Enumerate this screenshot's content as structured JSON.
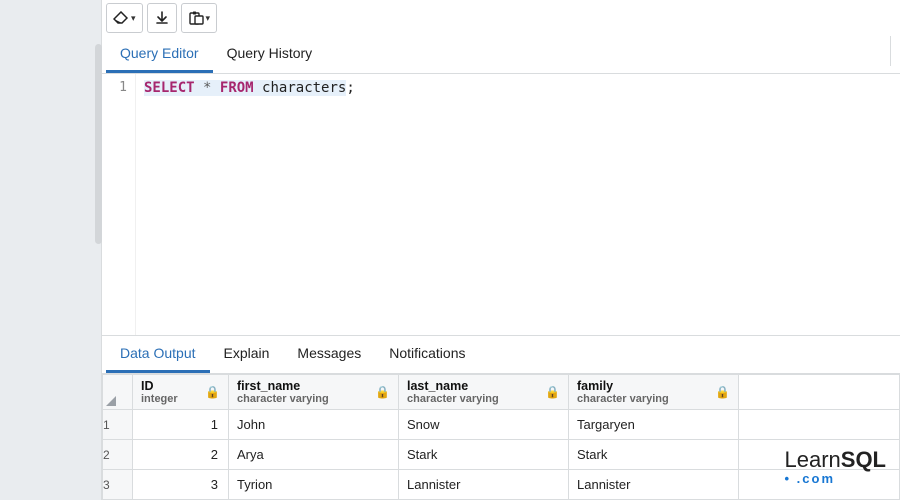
{
  "toolbar": {
    "buttons": [
      "erase",
      "download",
      "paste"
    ]
  },
  "editor_tabs": {
    "active": 0,
    "items": [
      "Query Editor",
      "Query History"
    ]
  },
  "editor": {
    "line_number": "1",
    "query_tokens": {
      "select": "SELECT",
      "star": "*",
      "from": "FROM",
      "table": "characters",
      "semicolon": ";"
    }
  },
  "output_tabs": {
    "active": 0,
    "items": [
      "Data Output",
      "Explain",
      "Messages",
      "Notifications"
    ]
  },
  "columns": [
    {
      "name": "ID",
      "type": "integer"
    },
    {
      "name": "first_name",
      "type": "character varying"
    },
    {
      "name": "last_name",
      "type": "character varying"
    },
    {
      "name": "family",
      "type": "character varying"
    }
  ],
  "rows": [
    {
      "n": "1",
      "ID": "1",
      "first_name": "John",
      "last_name": "Snow",
      "family": "Targaryen"
    },
    {
      "n": "2",
      "ID": "2",
      "first_name": "Arya",
      "last_name": "Stark",
      "family": "Stark"
    },
    {
      "n": "3",
      "ID": "3",
      "first_name": "Tyrion",
      "last_name": "Lannister",
      "family": "Lannister"
    }
  ],
  "watermark": {
    "brand_a": "Learn",
    "brand_b": "SQL",
    "sub": ".com"
  }
}
